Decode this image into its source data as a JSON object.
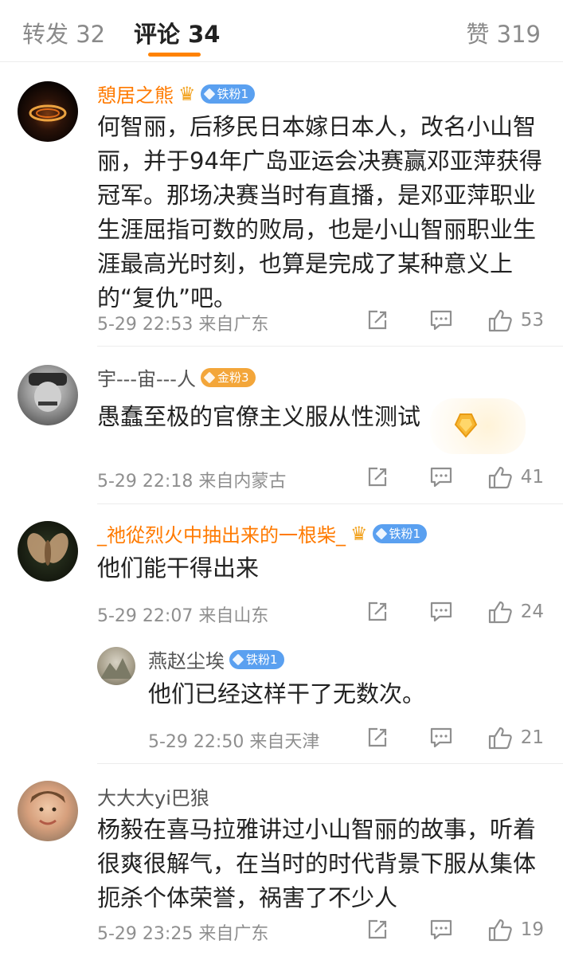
{
  "tabs": {
    "repost": "转发 32",
    "comments": "评论 34",
    "likes": "赞 319"
  },
  "colors": {
    "accent": "#ff8200",
    "vip_name": "#ff7a00",
    "badge_iron": "#5aa0f0",
    "badge_gold": "#f3a63a"
  },
  "comments": [
    {
      "username": "憩居之熊",
      "badge": "铁粉1",
      "text": "何智丽，后移民日本嫁日本人，改名小山智丽，并于94年广岛亚运会决赛赢邓亚萍获得冠军。那场决赛当时有直播，是邓亚萍职业生涯屈指可数的败局，也是小山智丽职业生涯最高光时刻，也算是完成了某种意义上的“复仇”吧。",
      "time": "5-29 22:53",
      "location": "来自广东",
      "likes": "53"
    },
    {
      "username": "宇---宙---人",
      "badge": "金粉3",
      "text": "愚蠢至极的官僚主义服从性测试",
      "time": "5-29 22:18",
      "location": "来自内蒙古",
      "likes": "41"
    },
    {
      "username": "_祂從烈火中抽出来的一根柴_",
      "badge": "铁粉1",
      "text": "他们能干得出来",
      "time": "5-29 22:07",
      "location": "来自山东",
      "likes": "24"
    },
    {
      "username": "燕赵尘埃",
      "badge": "铁粉1",
      "text": "他们已经这样干了无数次。",
      "time": "5-29 22:50",
      "location": "来自天津",
      "likes": "21"
    },
    {
      "username": "大大大yi巴狼",
      "badge": "",
      "text": "杨毅在喜马拉雅讲过小山智丽的故事，听着很爽很解气，在当时的时代背景下服从集体扼杀个体荣誉，祸害了不少人",
      "time": "5-29 23:25",
      "location": "来自广东",
      "likes": "19"
    }
  ]
}
